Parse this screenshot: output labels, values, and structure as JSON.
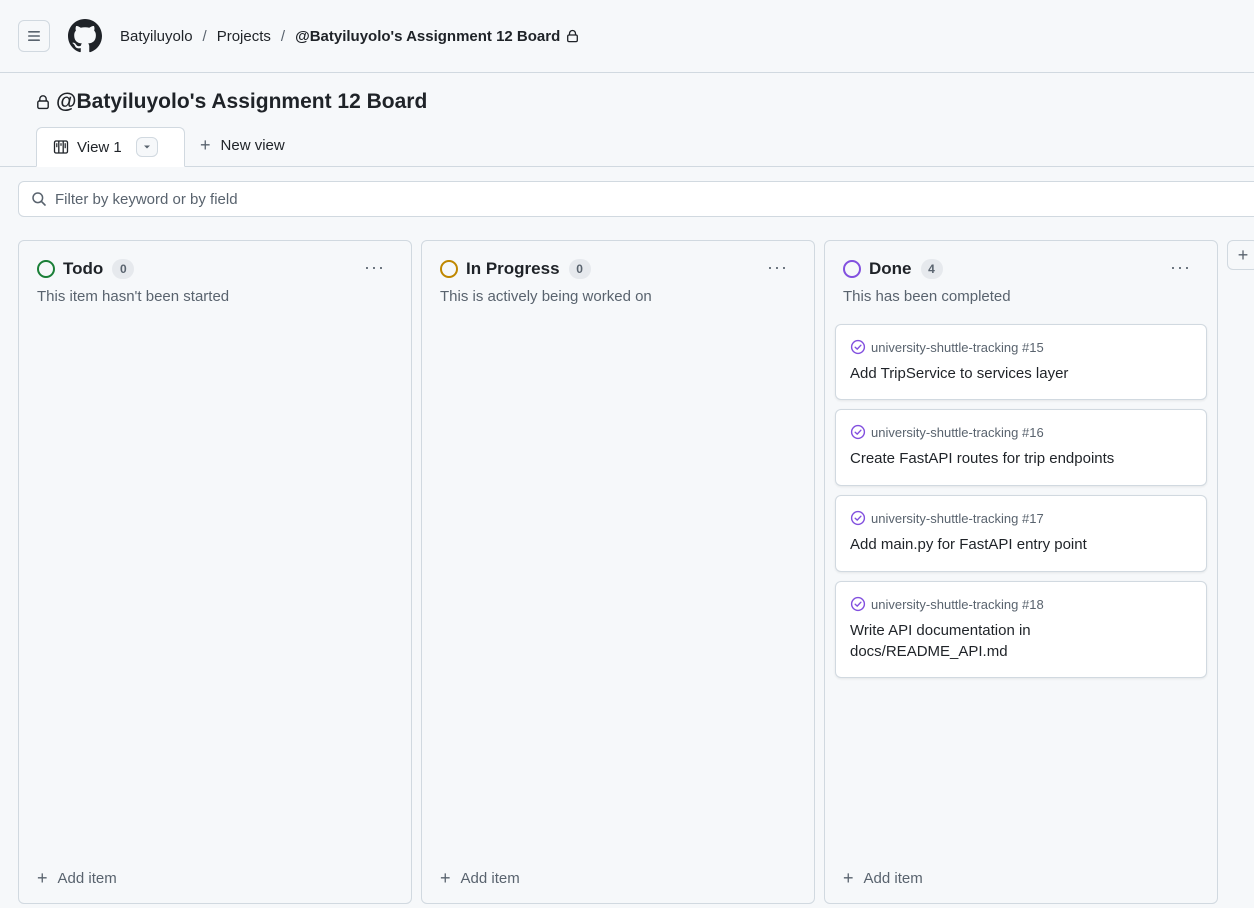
{
  "nav": {
    "owner": "Batyiluyolo",
    "section": "Projects",
    "project": "@Batyiluyolo's Assignment 12 Board",
    "separator": "/"
  },
  "header": {
    "title": "@Batyiluyolo's Assignment 12 Board"
  },
  "views": {
    "active_tab": "View 1",
    "new_view_label": "New view"
  },
  "filter": {
    "placeholder": "Filter by keyword or by field"
  },
  "columns": [
    {
      "name": "Todo",
      "count": "0",
      "description": "This item hasn't been started",
      "color": "#1a7f37",
      "add_item": "Add item"
    },
    {
      "name": "In Progress",
      "count": "0",
      "description": "This is actively being worked on",
      "color": "#9a6700",
      "add_item": "Add item"
    },
    {
      "name": "Done",
      "count": "4",
      "description": "This has been completed",
      "color": "#8250df",
      "add_item": "Add item",
      "cards": [
        {
          "repo": "university-shuttle-tracking #15",
          "title": "Add TripService to services layer"
        },
        {
          "repo": "university-shuttle-tracking #16",
          "title": "Create FastAPI routes for trip endpoints"
        },
        {
          "repo": "university-shuttle-tracking #17",
          "title": "Add main.py for FastAPI entry point"
        },
        {
          "repo": "university-shuttle-tracking #18",
          "title": "Write API documentation in docs/README_API.md"
        }
      ]
    }
  ],
  "icons": {
    "menu": "hamburger-icon",
    "logo": "github-logo",
    "lock": "lock-icon",
    "board": "board-view-icon",
    "search": "search-icon",
    "done": "check-circle-icon"
  }
}
